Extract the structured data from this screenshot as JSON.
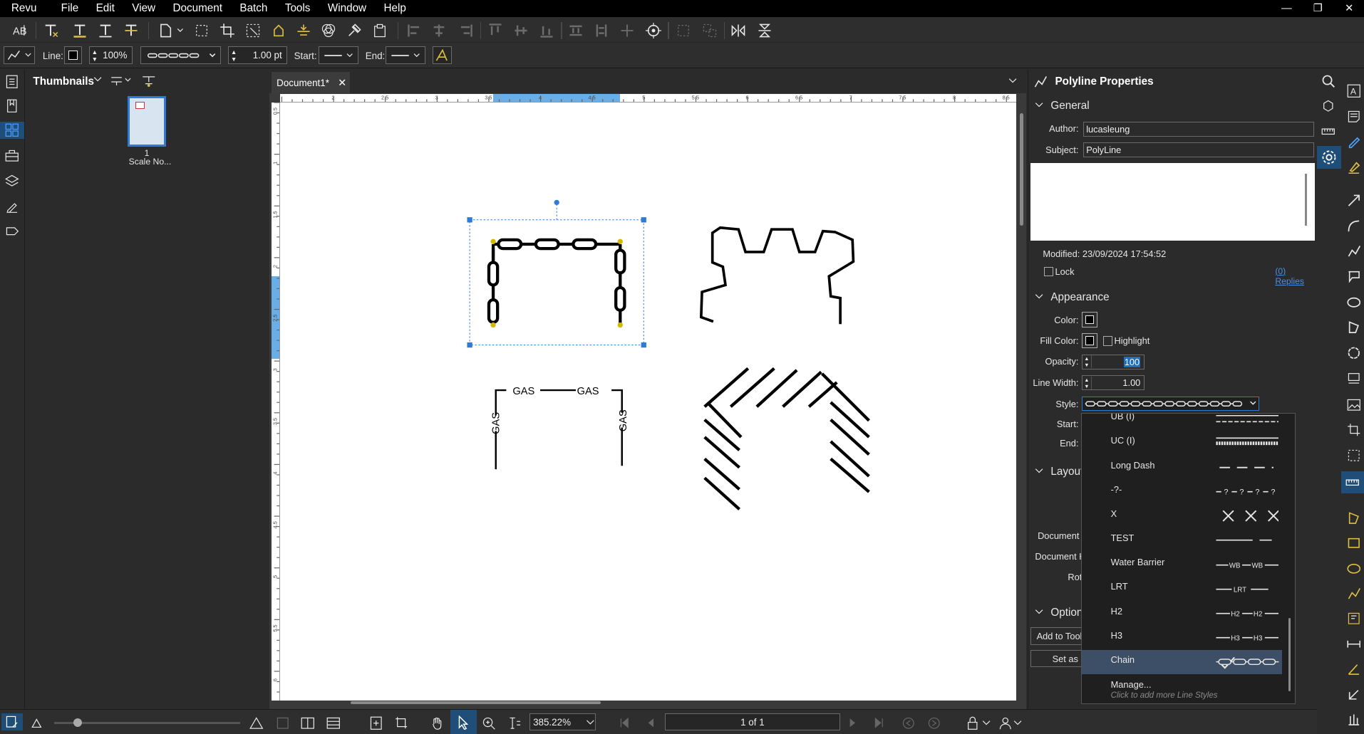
{
  "menu": [
    "Revu",
    "File",
    "Edit",
    "View",
    "Document",
    "Batch",
    "Tools",
    "Window",
    "Help"
  ],
  "window_controls": {
    "minimize": "—",
    "restore": "❐",
    "close": "✕"
  },
  "format_bar": {
    "line_label": "Line:",
    "opacity": "100%",
    "line_width": "1.00 pt",
    "start_label": "Start:",
    "end_label": "End:"
  },
  "thumbnails": {
    "title": "Thumbnails",
    "page_number": "1",
    "page_label": "Scale No..."
  },
  "document": {
    "tab_title": "Document1*",
    "ruler_top": [
      "2",
      "2.5",
      "3",
      "3.5",
      "4",
      "4.5",
      "5",
      "5.5",
      "6",
      "6.5",
      "7",
      "7.5",
      "8",
      "8.5",
      "9"
    ],
    "ruler_left": [
      "0.5",
      "1",
      "1.5",
      "2",
      "2.5",
      "3",
      "3.5",
      "4",
      "4.5",
      "5",
      "5.5",
      "6"
    ],
    "markup_labels": {
      "gas": "GAS"
    }
  },
  "properties": {
    "title": "Polyline Properties",
    "general": {
      "header": "General",
      "author_label": "Author:",
      "author": "lucasleung",
      "subject_label": "Subject:",
      "subject": "PolyLine",
      "modified": "Modified: 23/09/2024 17:54:52",
      "lock": "Lock",
      "replies": "(0) Replies"
    },
    "appearance": {
      "header": "Appearance",
      "color": "Color:",
      "fill_color": "Fill Color:",
      "highlight": "Highlight",
      "opacity_label": "Opacity:",
      "opacity": "100",
      "line_width_label": "Line Width:",
      "line_width": "1.00",
      "style_label": "Style:",
      "start_label": "Start:",
      "end_label": "End:"
    },
    "layout": {
      "header": "Layout",
      "document_w": "Document W",
      "document_h": "Document H",
      "rotation": "Rot"
    },
    "options": {
      "header": "Option",
      "add_to_tool": "Add to Tool",
      "set_as_default": "Set as D"
    }
  },
  "style_dropdown": {
    "items": [
      {
        "name": "UB (I)"
      },
      {
        "name": "UC (I)"
      },
      {
        "name": "Long Dash"
      },
      {
        "name": "-?-"
      },
      {
        "name": "X"
      },
      {
        "name": "TEST"
      },
      {
        "name": "Water Barrier"
      },
      {
        "name": "LRT"
      },
      {
        "name": "H2"
      },
      {
        "name": "H3"
      },
      {
        "name": "Chain",
        "selected": true
      }
    ],
    "preview_text": {
      "wb": "WB",
      "lrt": "LRT",
      "h2": "H2",
      "h3": "H3",
      "q": "?"
    },
    "manage": "Manage...",
    "manage_hint": "Click to add more Line Styles"
  },
  "statusbar": {
    "zoom": "385.22%",
    "page": "1 of 1"
  },
  "colors": {
    "accent": "#1f6fbf",
    "selection": "#2e7bd6",
    "page": "#ffffff",
    "panel": "#2b2b2b"
  }
}
